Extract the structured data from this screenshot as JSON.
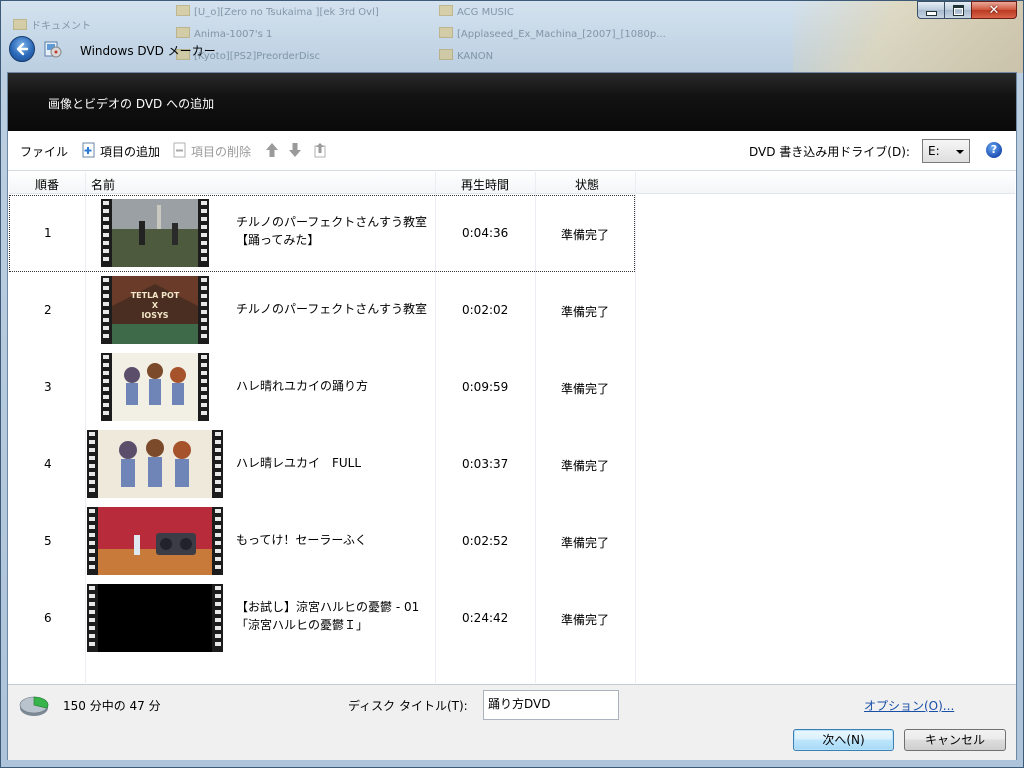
{
  "window": {
    "title": "Windows DVD メーカー",
    "background_files": [
      "ドキュメント",
      "[U_o][Zero no Tsukaima ][ek 3rd Ovl]",
      "Anima-1007's 1",
      "[Kyoto][PS2]PreorderDisc",
      "ACG MUSIC",
      "[Applaseed_Ex_Machina_[2007]_[1080p...",
      "KANON"
    ]
  },
  "header": {
    "title": "画像とビデオの DVD への追加"
  },
  "toolbar": {
    "file_label": "ファイル",
    "add_label": "項目の追加",
    "remove_label": "項目の削除",
    "drive_label": "DVD 書き込み用ドライブ(D):",
    "drive_value": "E:",
    "help_symbol": "?"
  },
  "columns": {
    "order": "順番",
    "name": "名前",
    "duration": "再生時間",
    "status": "状態"
  },
  "items": [
    {
      "order": "1",
      "name_line1": "チルノのパーフェクトさんすう教室",
      "name_line2": "【踊ってみた】",
      "duration": "0:04:36",
      "status": "準備完了"
    },
    {
      "order": "2",
      "name_line1": "チルノのパーフェクトさんすう教室",
      "name_line2": "",
      "duration": "0:02:02",
      "status": "準備完了"
    },
    {
      "order": "3",
      "name_line1": "ハレ晴れユカイの踊り方",
      "name_line2": "",
      "duration": "0:09:59",
      "status": "準備完了"
    },
    {
      "order": "4",
      "name_line1": "ハレ晴レユカイ　FULL",
      "name_line2": "",
      "duration": "0:03:37",
      "status": "準備完了"
    },
    {
      "order": "5",
      "name_line1": "もってけ！セーラーふく",
      "name_line2": "",
      "duration": "0:02:52",
      "status": "準備完了"
    },
    {
      "order": "6",
      "name_line1": "【お試し】涼宮ハルヒの憂鬱 - 01",
      "name_line2": "「涼宮ハルヒの憂鬱Ｉ」",
      "duration": "0:24:42",
      "status": "準備完了"
    }
  ],
  "thumbnail_overlay_text": {
    "line1": "TETLA POT",
    "line2": "X",
    "line3": "IOSYS"
  },
  "footer": {
    "usage_text": "150 分中の 47 分",
    "usage_used_minutes": 47,
    "usage_total_minutes": 150,
    "disc_title_label": "ディスク タイトル(T):",
    "disc_title_value": "踊り方DVD",
    "options_link": "オプション(O)...",
    "next_button": "次へ(N)",
    "cancel_button": "キャンセル"
  },
  "colors": {
    "header_band": "#121212",
    "link": "#1a4fa8",
    "pie_used": "#37b44a",
    "pie_free": "#b9c3cd"
  }
}
